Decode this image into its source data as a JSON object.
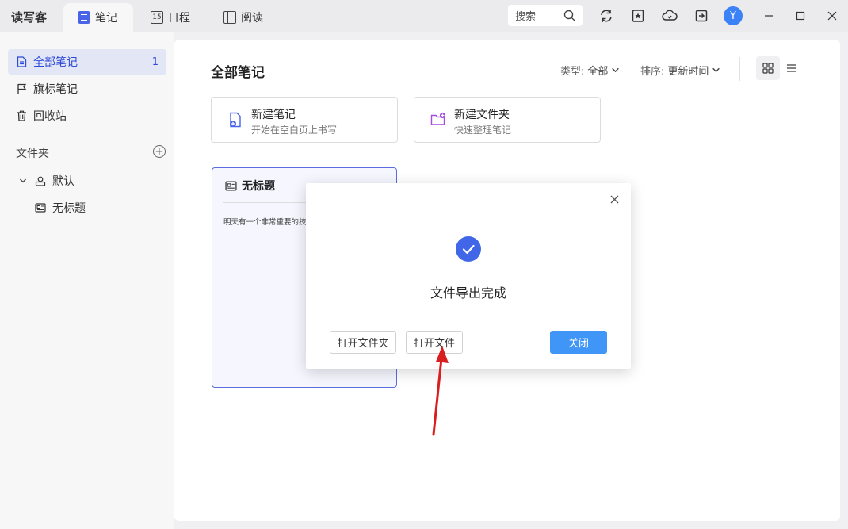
{
  "app": {
    "name": "读写客"
  },
  "tabs": [
    {
      "label": "笔记",
      "icon": "notes-icon",
      "active": true
    },
    {
      "label": "日程",
      "icon": "calendar-15-icon",
      "badge": "15"
    },
    {
      "label": "阅读",
      "icon": "book-icon"
    }
  ],
  "titlebar": {
    "search_label": "搜索",
    "avatar_letter": "Y",
    "icons": [
      "sync-icon",
      "star-note-icon",
      "cloud-icon",
      "export-icon"
    ]
  },
  "sidebar": {
    "items": [
      {
        "label": "全部笔记",
        "count": "1",
        "icon": "document-icon"
      },
      {
        "label": "旗标笔记",
        "icon": "flag-icon"
      },
      {
        "label": "回收站",
        "icon": "trash-icon"
      }
    ],
    "folders_label": "文件夹",
    "folder_tree": [
      {
        "label": "默认",
        "icon": "person-folder-icon"
      },
      {
        "label": "无标题",
        "icon": "note-card-icon"
      }
    ]
  },
  "main": {
    "title": "全部笔记",
    "filter_type_label": "类型:",
    "filter_type_value": "全部",
    "filter_sort_label": "排序:",
    "filter_sort_value": "更新时间",
    "actions": [
      {
        "title": "新建笔记",
        "subtitle": "开始在空白页上书写",
        "icon": "new-note-icon",
        "color": "#4a64e8"
      },
      {
        "title": "新建文件夹",
        "subtitle": "快速整理笔记",
        "icon": "new-folder-icon",
        "color": "#a64be0"
      }
    ],
    "note": {
      "title": "无标题",
      "preview": "明天有一个非常重要的技"
    }
  },
  "dialog": {
    "message": "文件导出完成",
    "open_folder": "打开文件夹",
    "open_file": "打开文件",
    "close": "关闭"
  },
  "colors": {
    "accent": "#4167e8",
    "primary_button": "#4096f7",
    "arrow": "#d81e1e"
  }
}
